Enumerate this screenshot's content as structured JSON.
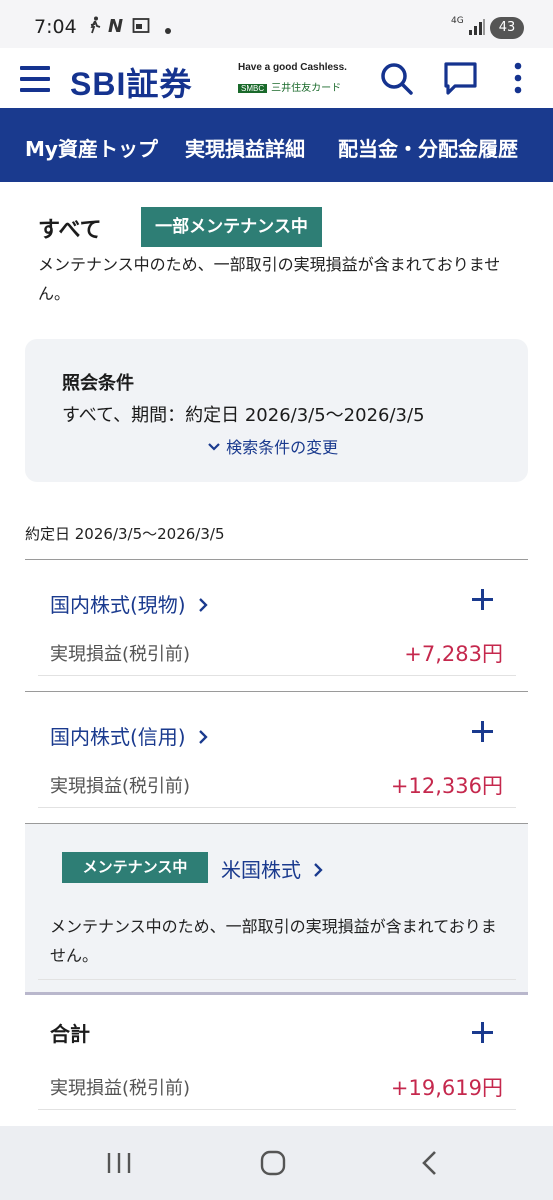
{
  "status_bar": {
    "time": "7:04",
    "network": "4G",
    "battery": "43"
  },
  "header": {
    "logo": "SBI証券",
    "brand_line1": "Have a good Cashless.",
    "brand_line2_prefix": "SMBC",
    "brand_line2": "三井住友カード",
    "icons": [
      "menu-icon",
      "search-icon",
      "chat-icon",
      "more-vertical-icon"
    ],
    "brand_color": "#15338f"
  },
  "nav": {
    "items": [
      "My資産トップ",
      "実現損益詳細",
      "配当金・分配金履歴"
    ],
    "bg_color": "#1a3a8e"
  },
  "summary": {
    "title": "すべて",
    "maintenance_badge": "一部メンテナンス中",
    "maintenance_note": "メンテナンス中のため、一部取引の実現損益が含まれておりません。"
  },
  "conditions": {
    "label": "照会条件",
    "value": "すべて、期間：約定日 2026/3/5〜2026/3/5",
    "change_link": "検索条件の変更"
  },
  "date_range": "約定日 2026/3/5〜2026/3/5",
  "accounts": [
    {
      "title": "国内株式(現物)",
      "label": "実現損益(税引前)",
      "value": "+7,283円"
    },
    {
      "title": "国内株式(信用)",
      "label": "実現損益(税引前)",
      "value": "+12,336円"
    }
  ],
  "us_stock": {
    "badge": "メンテナンス中",
    "title": "米国株式",
    "note": "メンテナンス中のため、一部取引の実現損益が含まれておりません。"
  },
  "total": {
    "title": "合計",
    "label": "実現損益(税引前)",
    "value": "+19,619円"
  },
  "colors": {
    "accent": "#1a3a8e",
    "maintenance": "#2e7e75",
    "profit": "#c5284d"
  }
}
